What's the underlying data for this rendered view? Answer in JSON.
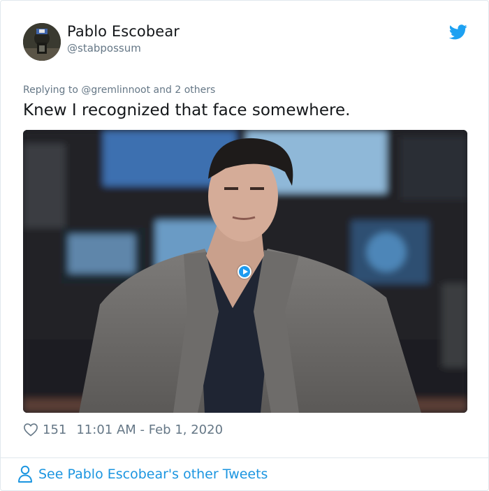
{
  "tweet": {
    "author": {
      "display_name": "Pablo Escobear",
      "handle": "@stabpossum"
    },
    "reply_context": "Replying to @gremlinnoot and 2 others",
    "text": "Knew I recognized that face somewhere.",
    "media": {
      "type": "video",
      "icon": "play-icon"
    },
    "likes": "151",
    "timestamp": "11:01 AM - Feb 1, 2020",
    "other_tweets_link": "See Pablo Escobear's other Tweets"
  },
  "colors": {
    "twitter_blue": "#1da1f2",
    "link_blue": "#1b95e0",
    "secondary_text": "#657786",
    "primary_text": "#14171a",
    "border": "#e1e8ed"
  }
}
